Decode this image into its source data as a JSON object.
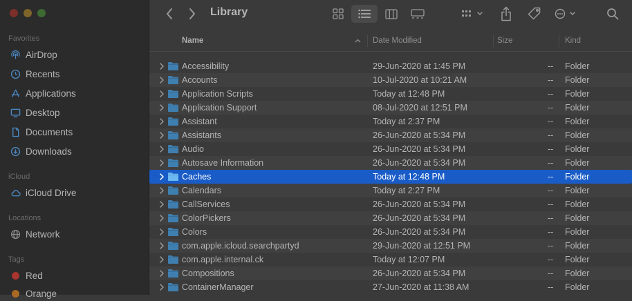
{
  "toolbar": {
    "title": "Library"
  },
  "sidebar": {
    "sections": [
      {
        "label": "Favorites",
        "items": [
          {
            "label": "AirDrop",
            "icon": "airdrop-icon"
          },
          {
            "label": "Recents",
            "icon": "clock-icon"
          },
          {
            "label": "Applications",
            "icon": "applications-icon"
          },
          {
            "label": "Desktop",
            "icon": "desktop-icon"
          },
          {
            "label": "Documents",
            "icon": "document-icon"
          },
          {
            "label": "Downloads",
            "icon": "download-icon"
          }
        ]
      },
      {
        "label": "iCloud",
        "items": [
          {
            "label": "iCloud Drive",
            "icon": "cloud-icon"
          }
        ]
      },
      {
        "label": "Locations",
        "items": [
          {
            "label": "Network",
            "icon": "globe-icon"
          }
        ]
      },
      {
        "label": "Tags",
        "items": [
          {
            "label": "Red",
            "color": "#a8352e"
          },
          {
            "label": "Orange",
            "color": "#a86a24"
          }
        ]
      }
    ]
  },
  "columns": {
    "name": "Name",
    "date": "Date Modified",
    "size": "Size",
    "kind": "Kind"
  },
  "rows": [
    {
      "name": "Accessibility",
      "date": "29-Jun-2020 at 1:45 PM",
      "size": "--",
      "kind": "Folder"
    },
    {
      "name": "Accounts",
      "date": "10-Jul-2020 at 10:21 AM",
      "size": "--",
      "kind": "Folder"
    },
    {
      "name": "Application Scripts",
      "date": "Today at 12:48 PM",
      "size": "--",
      "kind": "Folder"
    },
    {
      "name": "Application Support",
      "date": "08-Jul-2020 at 12:51 PM",
      "size": "--",
      "kind": "Folder"
    },
    {
      "name": "Assistant",
      "date": "Today at 2:37 PM",
      "size": "--",
      "kind": "Folder"
    },
    {
      "name": "Assistants",
      "date": "26-Jun-2020 at 5:34 PM",
      "size": "--",
      "kind": "Folder"
    },
    {
      "name": "Audio",
      "date": "26-Jun-2020 at 5:34 PM",
      "size": "--",
      "kind": "Folder"
    },
    {
      "name": "Autosave Information",
      "date": "26-Jun-2020 at 5:34 PM",
      "size": "--",
      "kind": "Folder"
    },
    {
      "name": "Caches",
      "date": "Today at 12:48 PM",
      "size": "--",
      "kind": "Folder",
      "selected": true
    },
    {
      "name": "Calendars",
      "date": "Today at 2:27 PM",
      "size": "--",
      "kind": "Folder"
    },
    {
      "name": "CallServices",
      "date": "26-Jun-2020 at 5:34 PM",
      "size": "--",
      "kind": "Folder"
    },
    {
      "name": "ColorPickers",
      "date": "26-Jun-2020 at 5:34 PM",
      "size": "--",
      "kind": "Folder"
    },
    {
      "name": "Colors",
      "date": "26-Jun-2020 at 5:34 PM",
      "size": "--",
      "kind": "Folder"
    },
    {
      "name": "com.apple.icloud.searchpartyd",
      "date": "29-Jun-2020 at 12:51 PM",
      "size": "--",
      "kind": "Folder"
    },
    {
      "name": "com.apple.internal.ck",
      "date": "Today at 12:07 PM",
      "size": "--",
      "kind": "Folder"
    },
    {
      "name": "Compositions",
      "date": "26-Jun-2020 at 5:34 PM",
      "size": "--",
      "kind": "Folder"
    },
    {
      "name": "ContainerManager",
      "date": "27-Jun-2020 at 11:38 AM",
      "size": "--",
      "kind": "Folder"
    }
  ],
  "colors": {
    "selection": "#1a5cc7",
    "folder": "#3f7fb0",
    "folder_selected": "#6cb8f2"
  }
}
